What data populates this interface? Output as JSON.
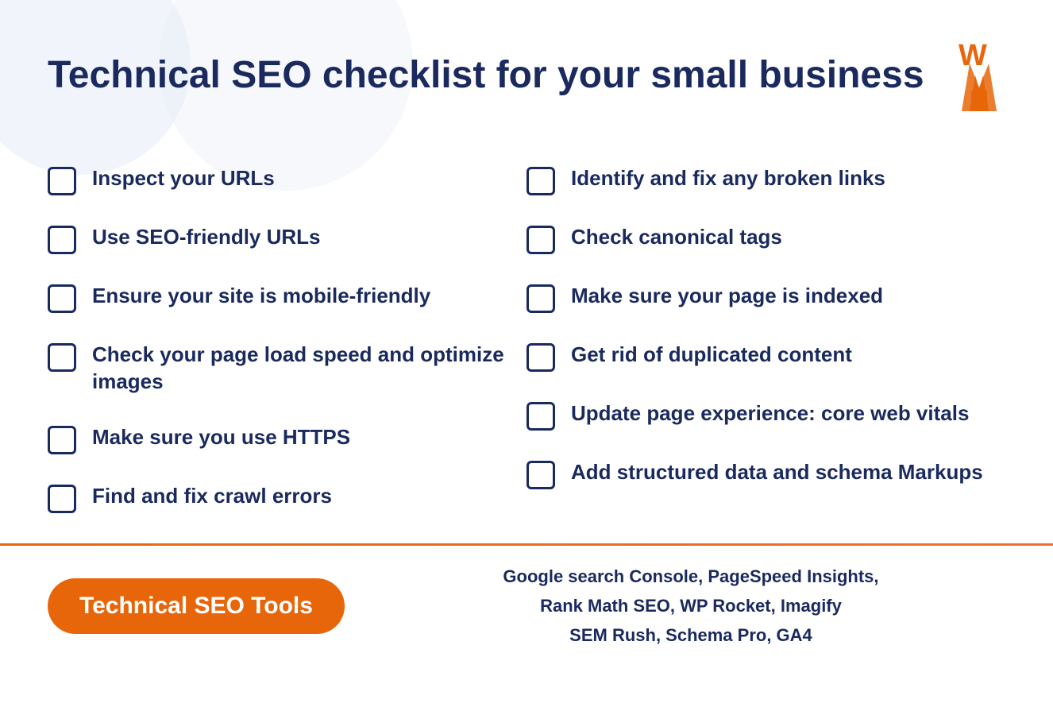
{
  "header": {
    "title": "Technical SEO checklist for your small business",
    "logo_alt": "W logo"
  },
  "checklist": {
    "left_column": [
      "Inspect your URLs",
      "Use SEO-friendly URLs",
      "Ensure your site is mobile-friendly",
      "Check your page load speed and optimize images",
      "Make sure you use HTTPS",
      "Find and fix crawl errors"
    ],
    "right_column": [
      "Identify and fix any broken links",
      "Check canonical tags",
      "Make sure your page is indexed",
      "Get rid of duplicated content",
      "Update page experience: core web vitals",
      "Add structured data and schema Markups"
    ]
  },
  "footer": {
    "badge_label": "Technical SEO Tools",
    "tools_line1": "Google search Console, PageSpeed Insights,",
    "tools_line2": "Rank Math SEO, WP Rocket, Imagify",
    "tools_line3": "SEM Rush, Schema Pro, GA4"
  },
  "colors": {
    "primary_dark": "#1a2a5e",
    "accent_orange": "#e8660a",
    "background": "#ffffff",
    "bg_circles": "#e8eef8"
  }
}
